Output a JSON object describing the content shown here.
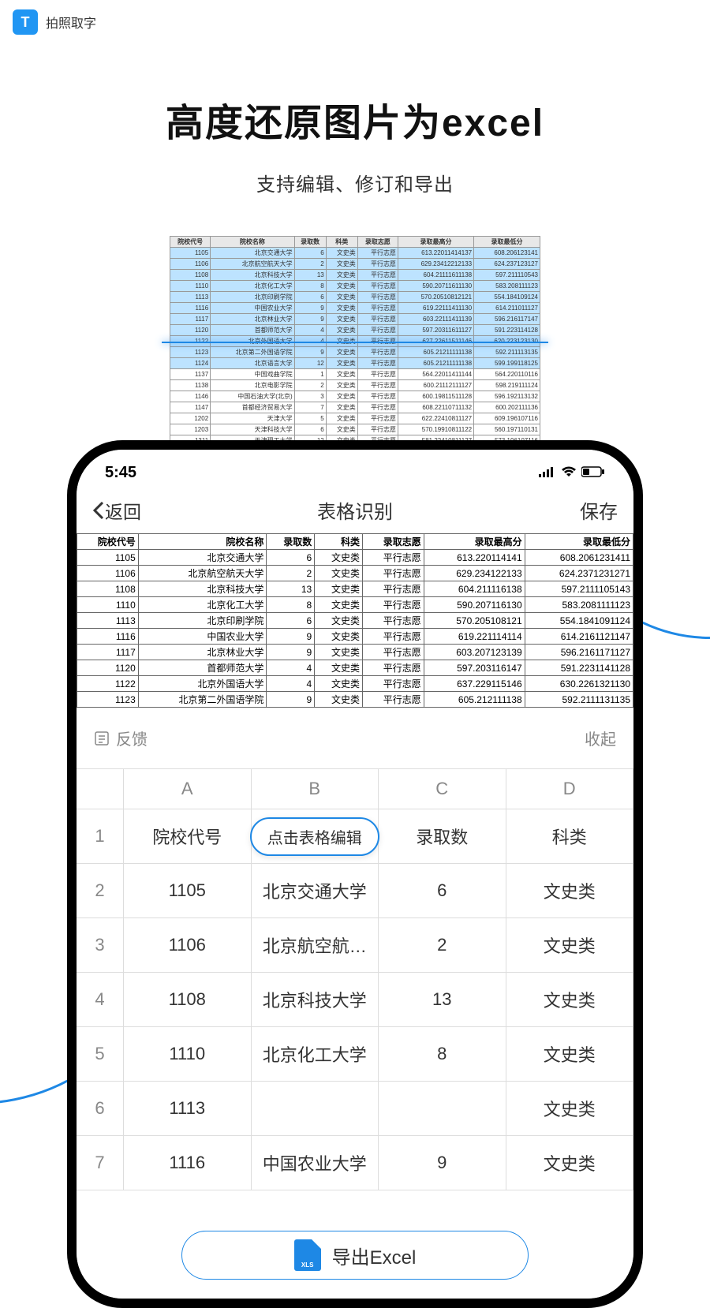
{
  "header": {
    "logo": "T",
    "app_name": "拍照取字"
  },
  "hero": {
    "title": "高度还原图片为excel",
    "subtitle": "支持编辑、修订和导出"
  },
  "scan_headers": [
    "院校代号",
    "院校名称",
    "录取数",
    "科类",
    "录取志愿",
    "录取最高分",
    "录取最低分"
  ],
  "scan_rows": [
    {
      "hl": true,
      "c": [
        "1105",
        "北京交通大学",
        "6",
        "文史类",
        "平行志愿",
        "613.22011414137",
        "608.206123141"
      ]
    },
    {
      "hl": true,
      "c": [
        "1106",
        "北京航空航天大学",
        "2",
        "文史类",
        "平行志愿",
        "629.23412212133",
        "624.237123127"
      ]
    },
    {
      "hl": true,
      "c": [
        "1108",
        "北京科技大学",
        "13",
        "文史类",
        "平行志愿",
        "604.21111611138",
        "597.211110543"
      ]
    },
    {
      "hl": true,
      "c": [
        "1110",
        "北京化工大学",
        "8",
        "文史类",
        "平行志愿",
        "590.20711611130",
        "583.208111123"
      ]
    },
    {
      "hl": true,
      "c": [
        "1113",
        "北京印刷学院",
        "6",
        "文史类",
        "平行志愿",
        "570.20510812121",
        "554.184109124"
      ]
    },
    {
      "hl": true,
      "c": [
        "1116",
        "中国农业大学",
        "9",
        "文史类",
        "平行志愿",
        "619.22111411130",
        "614.211011127"
      ]
    },
    {
      "hl": true,
      "c": [
        "1117",
        "北京林业大学",
        "9",
        "文史类",
        "平行志愿",
        "603.22111411139",
        "596.216117147"
      ]
    },
    {
      "hl": true,
      "c": [
        "1120",
        "首都师范大学",
        "4",
        "文史类",
        "平行志愿",
        "597.20311611127",
        "591.223114128"
      ]
    },
    {
      "hl": true,
      "c": [
        "1122",
        "北京外国语大学",
        "4",
        "文史类",
        "平行志愿",
        "627.22611511146",
        "620.223123130"
      ]
    },
    {
      "hl": true,
      "c": [
        "1123",
        "北京第二外国语学院",
        "9",
        "文史类",
        "平行志愿",
        "605.21211111138",
        "592.211113135"
      ]
    },
    {
      "hl": true,
      "c": [
        "1124",
        "北京语言大学",
        "12",
        "文史类",
        "平行志愿",
        "605.21211111138",
        "599.199118125"
      ]
    },
    {
      "hl": false,
      "c": [
        "1137",
        "中国戏曲学院",
        "1",
        "文史类",
        "平行志愿",
        "564.22011411144",
        "564.220110116"
      ]
    },
    {
      "hl": false,
      "c": [
        "1138",
        "北京电影学院",
        "2",
        "文史类",
        "平行志愿",
        "600.21112111127",
        "598.219111124"
      ]
    },
    {
      "hl": false,
      "c": [
        "1146",
        "中国石油大学(北京)",
        "3",
        "文史类",
        "平行志愿",
        "600.19811511128",
        "596.192113132"
      ]
    },
    {
      "hl": false,
      "c": [
        "1147",
        "首都经济贸易大学",
        "7",
        "文史类",
        "平行志愿",
        "608.22110711132",
        "600.202111136"
      ]
    },
    {
      "hl": false,
      "c": [
        "1202",
        "天津大学",
        "5",
        "文史类",
        "平行志愿",
        "622.22410811127",
        "609.196107116"
      ]
    },
    {
      "hl": false,
      "c": [
        "1203",
        "天津科技大学",
        "6",
        "文史类",
        "平行志愿",
        "570.19910811122",
        "560.197110131"
      ]
    },
    {
      "hl": false,
      "c": [
        "1311",
        "天津理工大学",
        "12",
        "文史类",
        "平行志愿",
        "581.22410811127",
        "573.196107116"
      ]
    }
  ],
  "phone": {
    "time": "5:45",
    "nav": {
      "back": "返回",
      "title": "表格识别",
      "save": "保存"
    },
    "inner_headers": [
      "院校代号",
      "院校名称",
      "录取数",
      "科类",
      "录取志愿",
      "录取最高分",
      "录取最低分"
    ],
    "inner_rows": [
      [
        "1105",
        "北京交通大学",
        "6",
        "文史类",
        "平行志愿",
        "613.220114141",
        "608.2061231411"
      ],
      [
        "1106",
        "北京航空航天大学",
        "2",
        "文史类",
        "平行志愿",
        "629.234122133",
        "624.2371231271"
      ],
      [
        "1108",
        "北京科技大学",
        "13",
        "文史类",
        "平行志愿",
        "604.211116138",
        "597.2111105143"
      ],
      [
        "1110",
        "北京化工大学",
        "8",
        "文史类",
        "平行志愿",
        "590.207116130",
        "583.2081111123"
      ],
      [
        "1113",
        "北京印刷学院",
        "6",
        "文史类",
        "平行志愿",
        "570.205108121",
        "554.1841091124"
      ],
      [
        "1116",
        "中国农业大学",
        "9",
        "文史类",
        "平行志愿",
        "619.221114114",
        "614.2161121147"
      ],
      [
        "1117",
        "北京林业大学",
        "9",
        "文史类",
        "平行志愿",
        "603.207123139",
        "596.2161171127"
      ],
      [
        "1120",
        "首都师范大学",
        "4",
        "文史类",
        "平行志愿",
        "597.203116147",
        "591.2231141128"
      ],
      [
        "1122",
        "北京外国语大学",
        "4",
        "文史类",
        "平行志愿",
        "637.229115146",
        "630.2261321130"
      ],
      [
        "1123",
        "北京第二外国语学院",
        "9",
        "文史类",
        "平行志愿",
        "605.212111138",
        "592.2111131135"
      ]
    ],
    "feedback": "反馈",
    "collapse": "收起",
    "sheet_cols": [
      "A",
      "B",
      "C",
      "D"
    ],
    "sheet_rows": [
      {
        "n": "1",
        "c": [
          "院校代号",
          "",
          "录取数",
          "科类"
        ]
      },
      {
        "n": "2",
        "c": [
          "1105",
          "北京交通大学",
          "6",
          "文史类"
        ]
      },
      {
        "n": "3",
        "c": [
          "1106",
          "北京航空航…",
          "2",
          "文史类"
        ]
      },
      {
        "n": "4",
        "c": [
          "1108",
          "北京科技大学",
          "13",
          "文史类"
        ]
      },
      {
        "n": "5",
        "c": [
          "1110",
          "北京化工大学",
          "8",
          "文史类"
        ]
      },
      {
        "n": "6",
        "c": [
          "1113",
          "",
          "",
          "文史类"
        ]
      },
      {
        "n": "7",
        "c": [
          "1116",
          "中国农业大学",
          "9",
          "文史类"
        ]
      }
    ],
    "edit_hint": "点击表格编辑",
    "export_label": "导出Excel"
  }
}
